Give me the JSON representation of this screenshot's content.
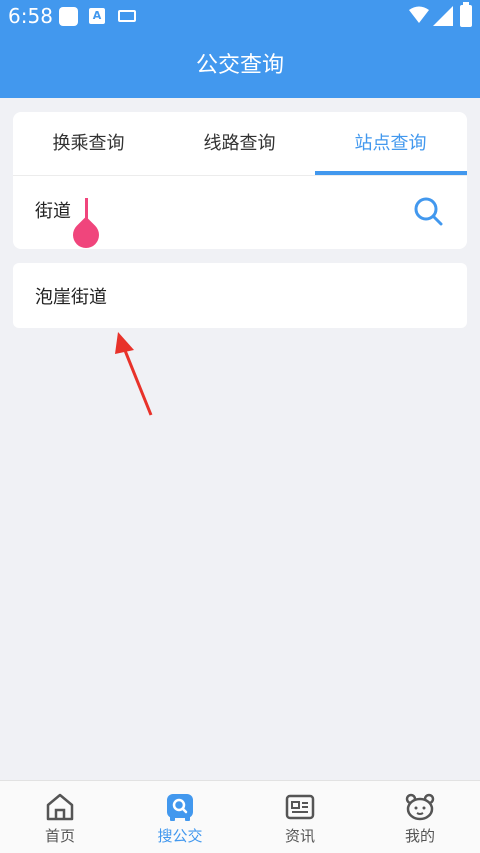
{
  "status_bar": {
    "time": "6:58"
  },
  "header": {
    "title": "公交查询"
  },
  "tabs": [
    {
      "label": "换乘查询",
      "active": false
    },
    {
      "label": "线路查询",
      "active": false
    },
    {
      "label": "站点查询",
      "active": true
    }
  ],
  "search": {
    "value": "街道"
  },
  "results": [
    {
      "label": "泡崖街道"
    }
  ],
  "bottom_nav": [
    {
      "label": "首页",
      "icon": "home-icon"
    },
    {
      "label": "搜公交",
      "icon": "bus-search-icon",
      "active": true
    },
    {
      "label": "资讯",
      "icon": "news-icon"
    },
    {
      "label": "我的",
      "icon": "bear-face-icon"
    }
  ],
  "colors": {
    "accent": "#4298ee",
    "caret": "#f0457c",
    "annotation_arrow": "#e8322a",
    "background": "#f0f1f5"
  }
}
